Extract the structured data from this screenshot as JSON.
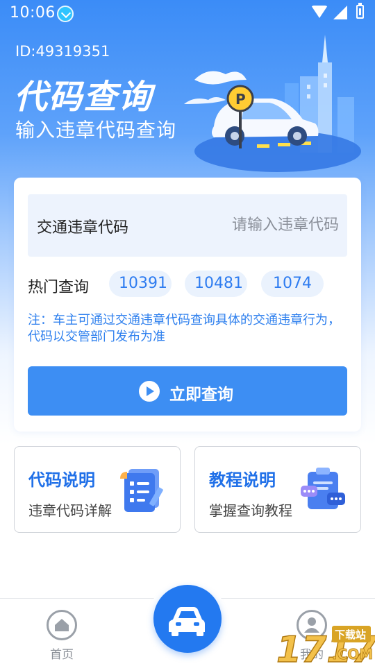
{
  "status_bar": {
    "time": "10:06"
  },
  "header": {
    "user_id": "ID:49319351",
    "title": "代码查询",
    "subtitle": "输入违章代码查询"
  },
  "query_card": {
    "input_label": "交通违章代码",
    "input_placeholder": "请输入违章代码",
    "input_value": "",
    "hot_label": "热门查询",
    "hot_codes": [
      "10391",
      "10481",
      "1074"
    ],
    "note": "注：车主可通过交通违章代码查询具体的交通违章行为，代码以交管部门发布为准",
    "submit_label": "立即查询"
  },
  "info_cards": [
    {
      "title": "代码说明",
      "subtitle": "违章代码详解",
      "icon": "document-list-icon"
    },
    {
      "title": "教程说明",
      "subtitle": "掌握查询教程",
      "icon": "clipboard-chat-icon"
    }
  ],
  "bottom_nav": {
    "home_label": "首页",
    "center_icon": "car-icon",
    "profile_label": "我的"
  },
  "watermark": {
    "text": "17178",
    "badge": "下载站",
    "domain": ".COM"
  },
  "colors": {
    "primary": "#3d8ef3",
    "accent_text": "#2f80ee",
    "card_title": "#2070e8",
    "chip_bg": "#eaf2fd"
  }
}
